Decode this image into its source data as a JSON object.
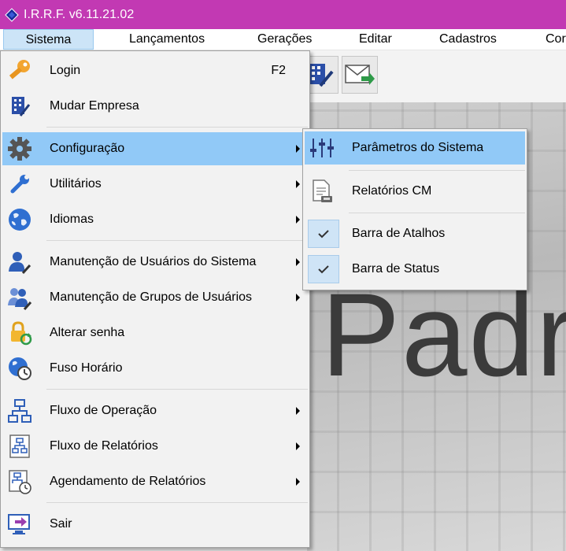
{
  "window": {
    "title": "I.R.R.F. v6.11.21.02"
  },
  "menubar": {
    "items": [
      {
        "label": "Sistema"
      },
      {
        "label": "Lançamentos"
      },
      {
        "label": "Gerações"
      },
      {
        "label": "Editar"
      },
      {
        "label": "Cadastros"
      },
      {
        "label": "Cor"
      }
    ]
  },
  "background": {
    "big_text": "Padr"
  },
  "sistema_menu": {
    "items": [
      {
        "label": "Login",
        "shortcut": "F2",
        "icon": "key-icon"
      },
      {
        "label": "Mudar Empresa",
        "icon": "building-icon"
      },
      {
        "label": "Configuração",
        "icon": "gear-icon"
      },
      {
        "label": "Utilitários",
        "icon": "wrench-icon"
      },
      {
        "label": "Idiomas",
        "icon": "globe-icon"
      },
      {
        "label": "Manutenção de Usuários do Sistema",
        "icon": "user-wrench-icon"
      },
      {
        "label": "Manutenção de Grupos de Usuários",
        "icon": "users-wrench-icon"
      },
      {
        "label": "Alterar senha",
        "icon": "lock-refresh-icon"
      },
      {
        "label": "Fuso Horário",
        "icon": "globe-clock-icon"
      },
      {
        "label": "Fluxo de Operação",
        "icon": "flowchart-icon"
      },
      {
        "label": "Fluxo de Relatórios",
        "icon": "report-flow-icon"
      },
      {
        "label": "Agendamento de Relatórios",
        "icon": "report-schedule-icon"
      },
      {
        "label": "Sair",
        "icon": "exit-icon"
      }
    ]
  },
  "config_submenu": {
    "items": [
      {
        "label": "Parâmetros do Sistema",
        "icon": "sliders-icon"
      },
      {
        "label": "Relatórios CM",
        "icon": "report-icon"
      },
      {
        "label": "Barra de Atalhos",
        "checked": true
      },
      {
        "label": "Barra de Status",
        "checked": true
      }
    ]
  },
  "colors": {
    "titlebar": "#c239b3",
    "highlight": "#91c9f7",
    "menu_bg": "#f2f2f2"
  }
}
